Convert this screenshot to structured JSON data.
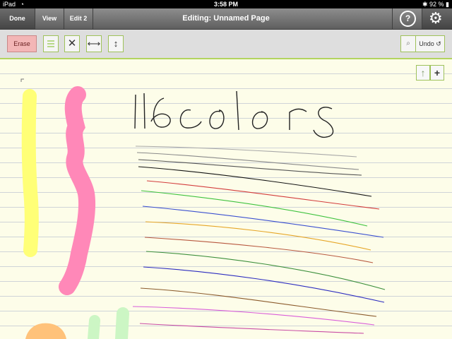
{
  "status_bar": {
    "device": "iPad",
    "time": "3:58 PM",
    "battery": "92 %",
    "wifi_icon": "wifi-icon",
    "bluetooth_icon": "bluetooth-icon"
  },
  "title_bar": {
    "tabs": [
      {
        "label": "Done"
      },
      {
        "label": "View"
      },
      {
        "label": "Edit 2"
      }
    ],
    "title": "Editing: Unnamed Page",
    "help_icon": "question-icon",
    "settings_icon": "gear-icon"
  },
  "toolbar": {
    "erase_label": "Erase",
    "undo_label": "Undo",
    "icons": [
      "lines-icon",
      "tools-icon",
      "horizontal-resize-icon",
      "vertical-resize-icon",
      "search-icon",
      "undo-icon"
    ]
  },
  "page_controls": {
    "up_icon": "up-arrow-icon",
    "add_icon": "plus-icon"
  },
  "colors": {
    "accent": "#b3d45f",
    "page": "#fdfde9",
    "rule": "#cfd4d8"
  },
  "drawing": {
    "handwriting": "16colors",
    "stroke_colors": [
      "#a8a8a8",
      "#8a8a8a",
      "#555555",
      "#111111",
      "#d33c3c",
      "#3ec23e",
      "#3a4fd0",
      "#e6a526",
      "#b8583f",
      "#3c8f3c",
      "#2c2cc0",
      "#8b5a2b",
      "#d95dd9",
      "#c94da5",
      "#ffff77",
      "#ff88b8"
    ]
  }
}
